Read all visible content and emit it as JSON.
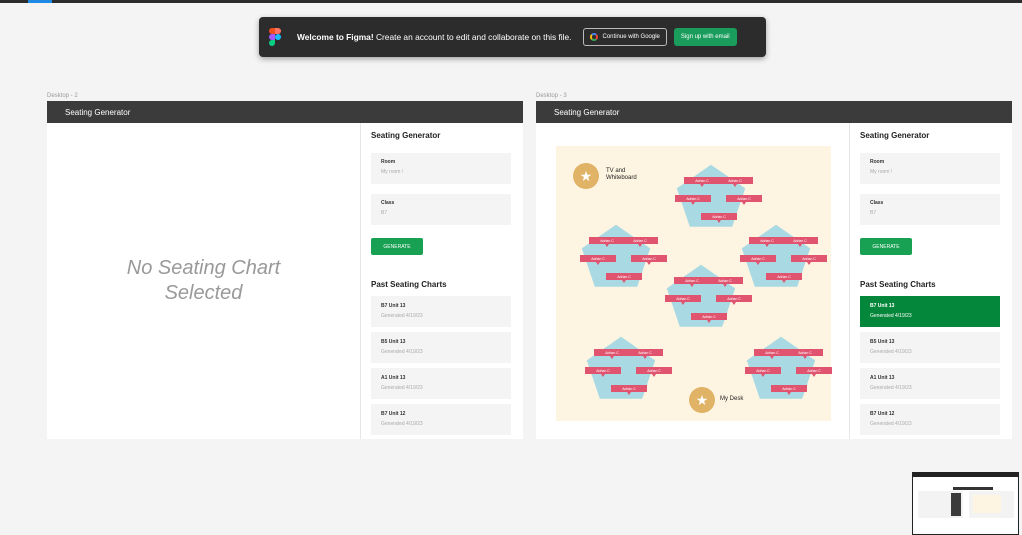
{
  "banner": {
    "title": "Welcome to Figma!",
    "message": " Create an account to edit and collaborate on this file.",
    "google_button": "Continue with Google",
    "email_button": "Sign up with email"
  },
  "frames": [
    {
      "label": "Desktop - 2",
      "header": "Seating Generator",
      "empty_message": "No Seating Chart Selected"
    },
    {
      "label": "Desktop - 3",
      "header": "Seating Generator"
    }
  ],
  "panel": {
    "title": "Seating Generator",
    "room_label": "Room",
    "room_placeholder": "My room !",
    "class_label": "Class",
    "class_placeholder": "B7",
    "generate_button": "GENERATE",
    "past_title": "Past Seating Charts",
    "past_charts": [
      {
        "name": "B7 Unit 13",
        "date": "Generated 4/19/23"
      },
      {
        "name": "B5 Unit 13",
        "date": "Generated 4/19/23"
      },
      {
        "name": "A1 Unit 13",
        "date": "Generated 4/19/23"
      },
      {
        "name": "B7 Unit 12",
        "date": "Generated 4/19/23"
      }
    ]
  },
  "room": {
    "tv_label_1": "TV and",
    "tv_label_2": "Whiteboard",
    "desk_label": "My Desk",
    "student_tag": "Adrian C",
    "star_icon": "star-icon",
    "colors": {
      "tables": "#a9d9e3",
      "tags": "#e05470",
      "floor": "#fdf5e2",
      "circle": "#e0b366"
    }
  },
  "colors": {
    "selected": "#05873b",
    "generate": "#18a152",
    "header": "#3b3b3b"
  }
}
